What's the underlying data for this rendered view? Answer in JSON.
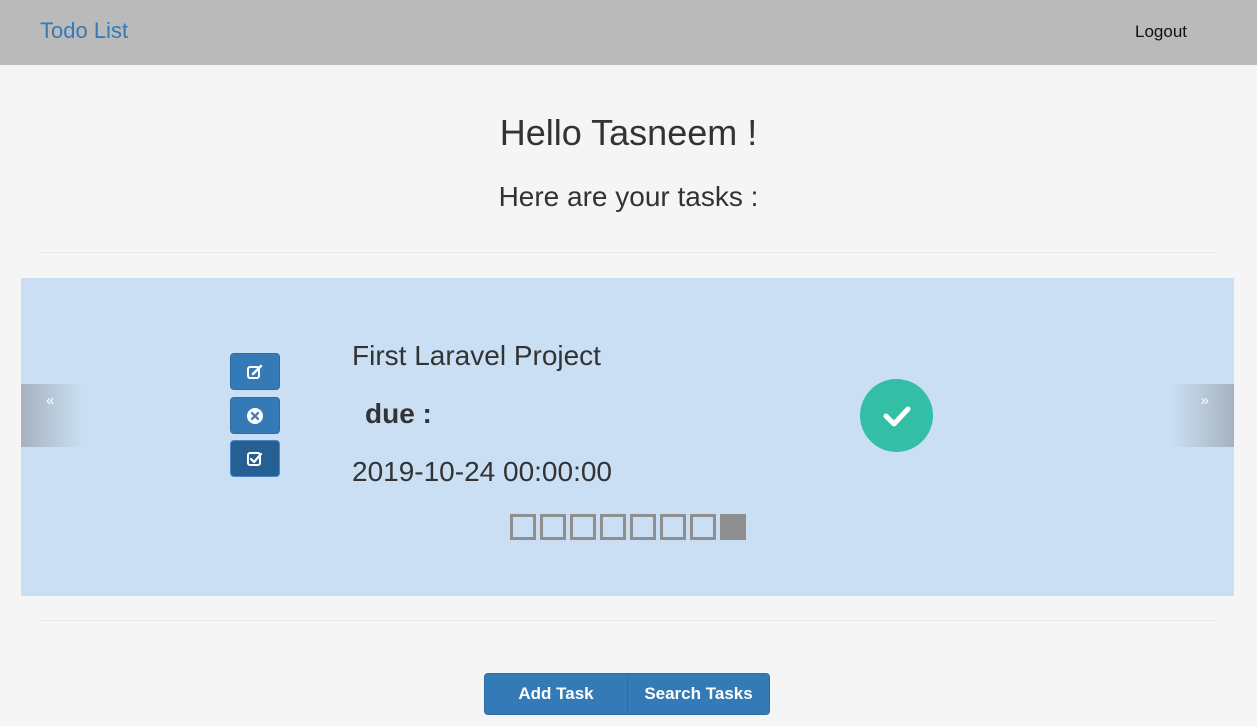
{
  "navbar": {
    "brand": "Todo List",
    "logout": "Logout"
  },
  "header": {
    "greeting": "Hello Tasneem !",
    "subtitle": "Here are your tasks :"
  },
  "carousel": {
    "prev_glyph": "«",
    "next_glyph": "»",
    "task": {
      "title": "First Laravel Project",
      "due_label": "due :",
      "due_date": "2019-10-24 00:00:00",
      "completed": true
    },
    "actions": [
      {
        "name": "edit",
        "icon": "edit-icon"
      },
      {
        "name": "delete",
        "icon": "times-circle-icon"
      },
      {
        "name": "mark-done",
        "icon": "check-square-icon"
      }
    ],
    "indicators": {
      "count": 8,
      "active_index": 7
    }
  },
  "footer_buttons": {
    "add": "Add Task",
    "search": "Search Tasks"
  },
  "colors": {
    "navbar": "#bababa",
    "brand": "#337ab7",
    "primary": "#337ab7",
    "carousel_bg": "#cadff3",
    "check_circle": "#33bfa5",
    "indicator": "#8f8f8f"
  }
}
